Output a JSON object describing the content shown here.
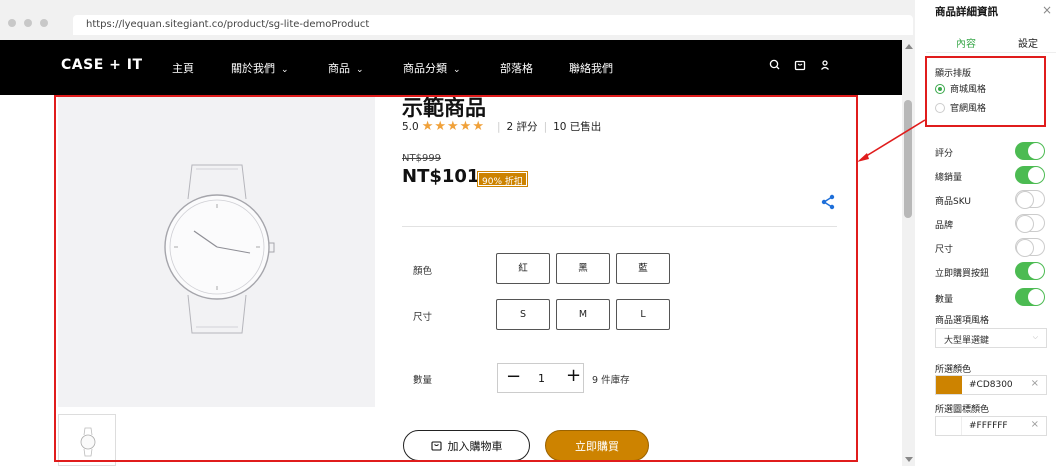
{
  "browser": {
    "url": "https://lyequan.sitegiant.co/product/sg-lite-demoProduct"
  },
  "nav": {
    "logo": "CASE + IT",
    "items": [
      {
        "label": "主頁",
        "chevron": false
      },
      {
        "label": "關於我們",
        "chevron": true
      },
      {
        "label": "商品",
        "chevron": true
      },
      {
        "label": "商品分類",
        "chevron": true
      },
      {
        "label": "部落格",
        "chevron": false
      },
      {
        "label": "聯絡我們",
        "chevron": false
      }
    ],
    "chevron_glyph": "⌄"
  },
  "product": {
    "title": "示範商品",
    "rating": "5.0",
    "stars": "★★★★★",
    "reviews": "2 評分",
    "sold": "10 已售出",
    "old_price": "NT$999",
    "price": "NT$101",
    "discount": "90% 折扣",
    "color_label": "顏色",
    "colors": [
      "紅",
      "黑",
      "藍"
    ],
    "size_label": "尺寸",
    "sizes": [
      "S",
      "M",
      "L"
    ],
    "qty_label": "數量",
    "qty": "1",
    "qty_minus": "−",
    "qty_plus": "+",
    "stock": "9 件庫存",
    "add_to_cart": "加入購物車",
    "buy_now": "立即購買"
  },
  "panel": {
    "title": "商品詳細資訊",
    "close": "×",
    "tabs": [
      "內容",
      "設定"
    ],
    "layout_label": "顯示排版",
    "layout_options": [
      {
        "label": "商城風格",
        "selected": true
      },
      {
        "label": "官網風格",
        "selected": false
      }
    ],
    "toggles": [
      {
        "label": "評分",
        "on": true
      },
      {
        "label": "總銷量",
        "on": true
      },
      {
        "label": "商品SKU",
        "on": false
      },
      {
        "label": "品牌",
        "on": false
      },
      {
        "label": "尺寸",
        "on": false
      },
      {
        "label": "立即購買按鈕",
        "on": true
      },
      {
        "label": "數量",
        "on": true
      }
    ],
    "option_style_label": "商品選項風格",
    "option_style_value": "大型單選鍵",
    "selected_color_label": "所選顏色",
    "selected_color": "#CD8300",
    "selected_icon_color_label": "所選圖標顏色",
    "selected_icon_color": "#FFFFFF",
    "clear_glyph": "×"
  },
  "colors": {
    "accent": "#CD8300",
    "toggle_on": "#4cbb52",
    "highlight": "#e01c1c",
    "nav_bg": "#000000"
  }
}
